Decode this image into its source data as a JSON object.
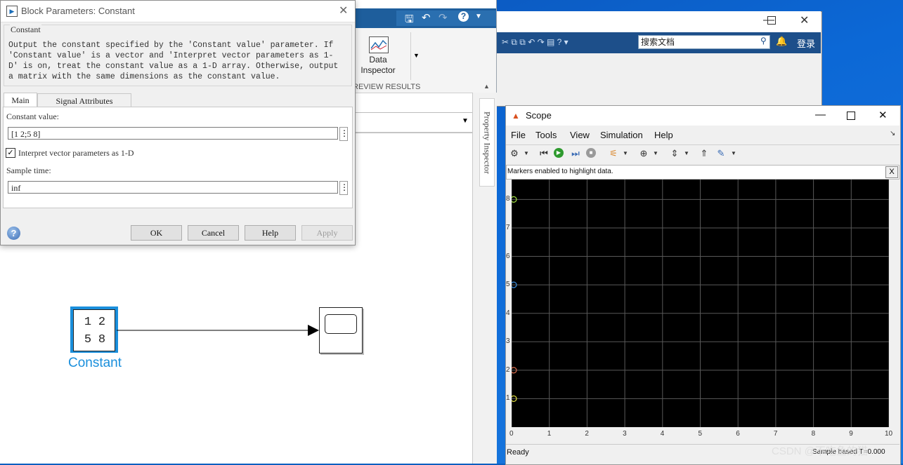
{
  "dialog": {
    "title": "Block Parameters: Constant",
    "group_label": "Constant",
    "description": "Output the constant specified by the 'Constant value' parameter. If 'Constant value' is a vector and 'Interpret vector parameters as 1-D' is on, treat the constant value as a 1-D array. Otherwise, output a matrix with the same dimensions as the constant value.",
    "tabs": [
      {
        "label": "Main",
        "active": true
      },
      {
        "label": "Signal Attributes",
        "active": false
      }
    ],
    "constant_label": "Constant value:",
    "constant_value": "[1 2;5 8]",
    "interpret_label": "Interpret vector parameters as 1-D",
    "interpret_checked": true,
    "sample_label": "Sample time:",
    "sample_value": "inf",
    "buttons": {
      "ok": "OK",
      "cancel": "Cancel",
      "help": "Help",
      "apply": "Apply"
    },
    "menu_glyph": "⋮"
  },
  "simulink": {
    "ribbon_button": "Data\nInspector",
    "ribbon_line1": "Data",
    "ribbon_line2": "Inspector",
    "ribbon_section": "REVIEW RESULTS",
    "property_inspector": "Property Inspector",
    "block": {
      "name": "Constant",
      "matrix": [
        "1",
        "2",
        "5",
        "8"
      ]
    }
  },
  "doc": {
    "search_placeholder": "搜索文档",
    "login": "登录"
  },
  "scope": {
    "title": "Scope",
    "menu": [
      "File",
      "Tools",
      "View",
      "Simulation",
      "Help"
    ],
    "info_bar": "Markers enabled to highlight data.",
    "info_close": "X",
    "status": "Ready",
    "status_right": "Sample based   T=0.000",
    "watermark": "CSDN @不吃鱼的猫"
  },
  "chart_data": {
    "type": "scatter",
    "x": [
      0,
      0,
      0,
      0
    ],
    "y": [
      1,
      2,
      5,
      8
    ],
    "xlim": [
      0,
      10
    ],
    "ylim": [
      0,
      8.7
    ],
    "xticks": [
      0,
      1,
      2,
      3,
      4,
      5,
      6,
      7,
      8,
      9,
      10
    ],
    "yticks": [
      1,
      2,
      3,
      4,
      5,
      6,
      7,
      8
    ],
    "grid": true,
    "marker_colors": [
      "#e8e640",
      "#e07050",
      "#3b8ee0",
      "#a0e040"
    ]
  },
  "colors": {
    "accent": "#1a8fdc",
    "scope_bg": "#000000",
    "grid": "#595959"
  }
}
